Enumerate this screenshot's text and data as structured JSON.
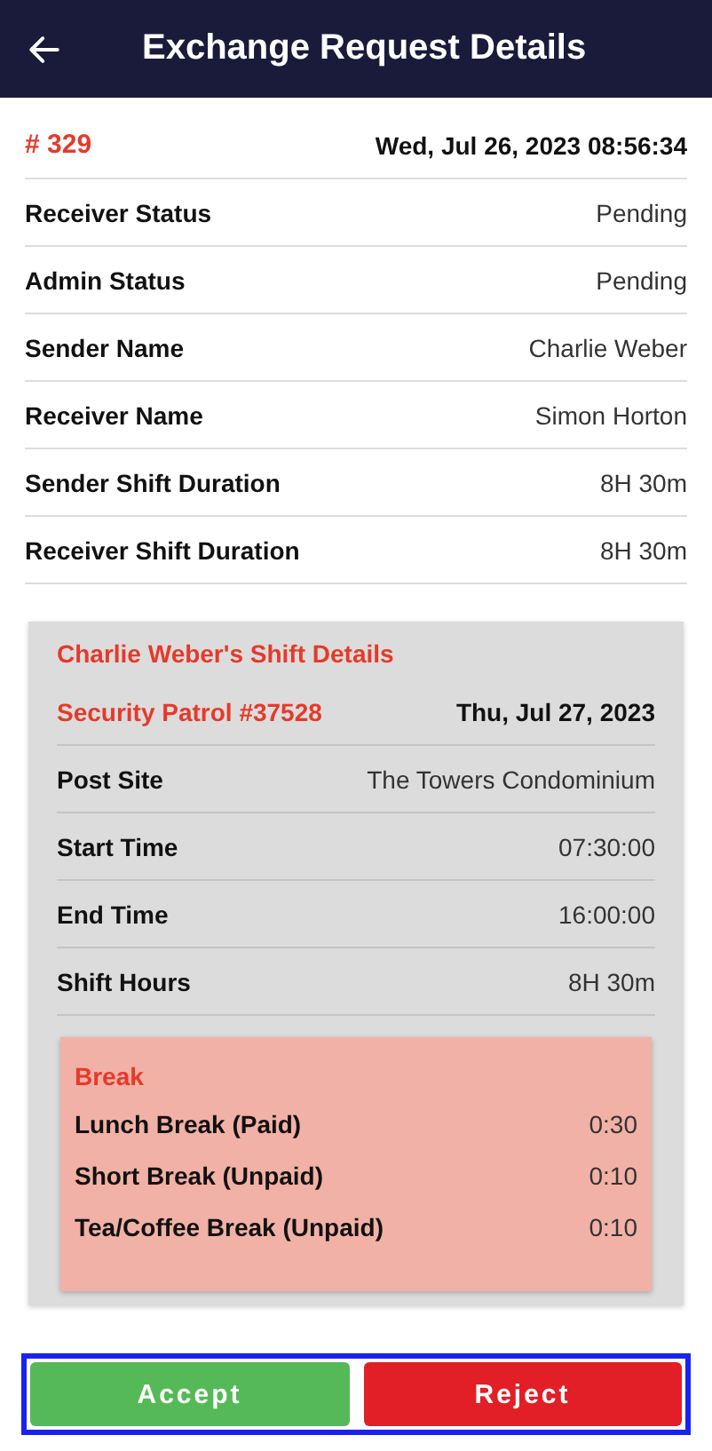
{
  "header": {
    "title": "Exchange Request Details"
  },
  "request": {
    "number": "# 329",
    "datetime": "Wed, Jul 26, 2023 08:56:34"
  },
  "details": [
    {
      "label": "Receiver Status",
      "value": "Pending"
    },
    {
      "label": "Admin Status",
      "value": "Pending"
    },
    {
      "label": "Sender Name",
      "value": "Charlie Weber"
    },
    {
      "label": "Receiver Name",
      "value": "Simon Horton"
    },
    {
      "label": "Sender Shift Duration",
      "value": "8H 30m"
    },
    {
      "label": "Receiver Shift Duration",
      "value": "8H 30m"
    }
  ],
  "shift_card": {
    "title": "Charlie Weber's Shift Details",
    "shift_name": "Security Patrol #37528",
    "date": "Thu, Jul 27, 2023",
    "rows": [
      {
        "label": "Post Site",
        "value": "The Towers Condominium"
      },
      {
        "label": "Start Time",
        "value": "07:30:00"
      },
      {
        "label": "End Time",
        "value": "16:00:00"
      },
      {
        "label": "Shift Hours",
        "value": "8H 30m"
      }
    ],
    "breaks": {
      "title": "Break",
      "items": [
        {
          "label": "Lunch Break (Paid)",
          "value": "0:30"
        },
        {
          "label": "Short Break (Unpaid)",
          "value": "0:10"
        },
        {
          "label": "Tea/Coffee Break (Unpaid)",
          "value": "0:10"
        }
      ]
    }
  },
  "actions": [
    {
      "label": "Accept",
      "kind": "accept"
    },
    {
      "label": "Reject",
      "kind": "reject"
    }
  ]
}
